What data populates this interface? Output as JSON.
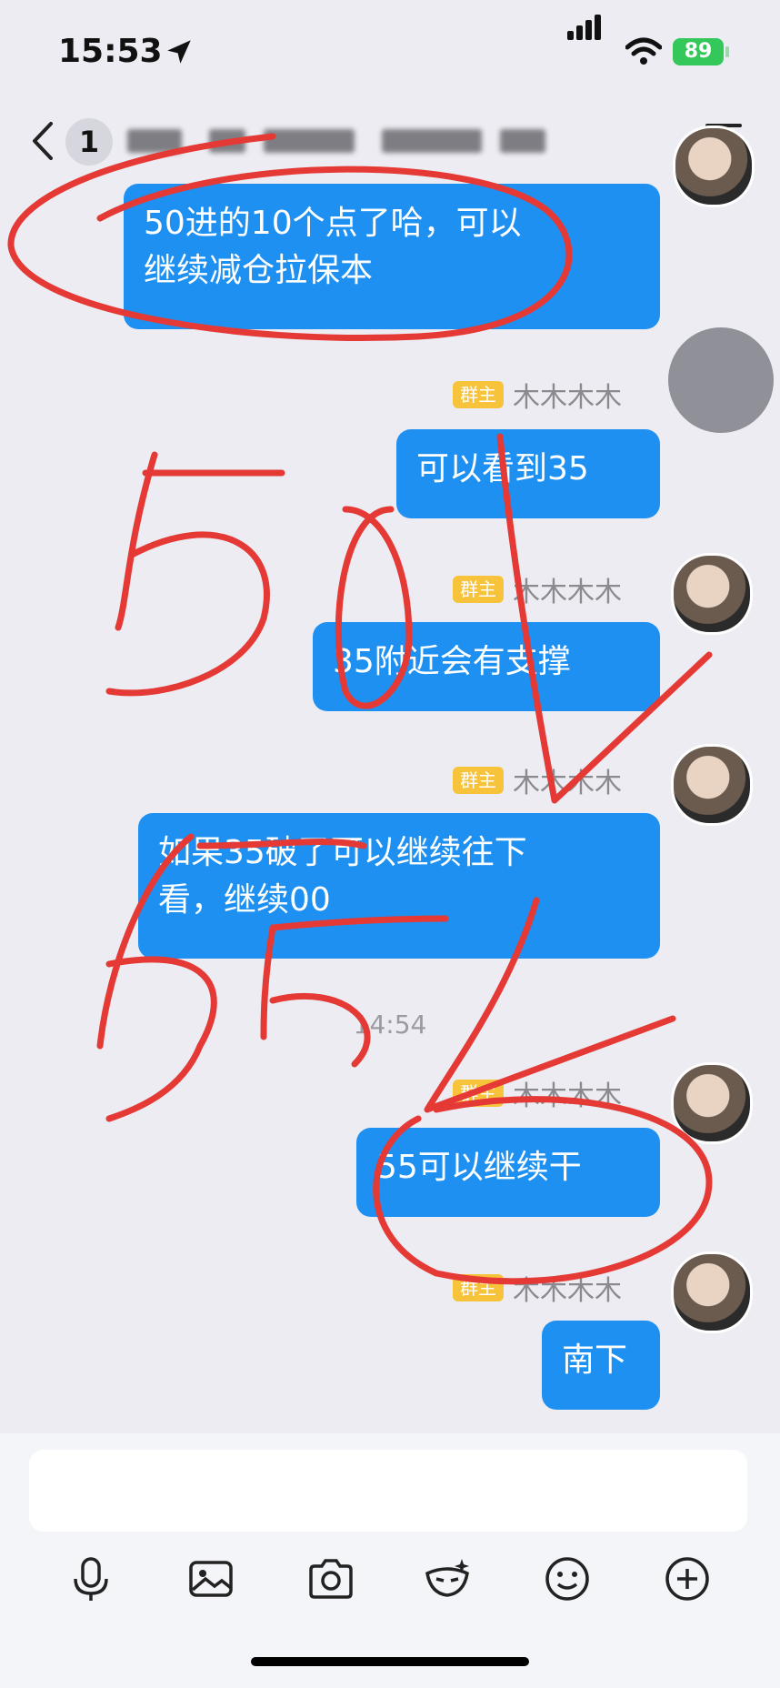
{
  "status_bar": {
    "time": "15:53",
    "battery": "89"
  },
  "header": {
    "unread_count": "1"
  },
  "messages": [
    {
      "text": "50进的10个点了哈，可以继续减仓拉保本",
      "line1": "50进的10个点了哈，可以",
      "line2": "继续减仓拉保本"
    },
    {
      "tag": "群主",
      "name": "木木木木",
      "text": "可以看到35"
    },
    {
      "tag": "群主",
      "name": "木木木木",
      "text": "35附近会有支撑"
    },
    {
      "tag": "群主",
      "name": "木木木木",
      "line1": "如果35破了可以继续往下",
      "line2": "看，继续00"
    },
    {
      "timestamp": "14:54"
    },
    {
      "tag": "群主",
      "name": "木木木木",
      "text": "55可以继续干"
    },
    {
      "tag": "群主",
      "name": "木木木木",
      "text": "南下"
    }
  ],
  "annotation": {
    "number_1": "50",
    "number_2": "55"
  },
  "toolbar": [
    "mic-icon",
    "image-icon",
    "camera-icon",
    "mask-icon",
    "emoji-icon",
    "plus-icon"
  ]
}
